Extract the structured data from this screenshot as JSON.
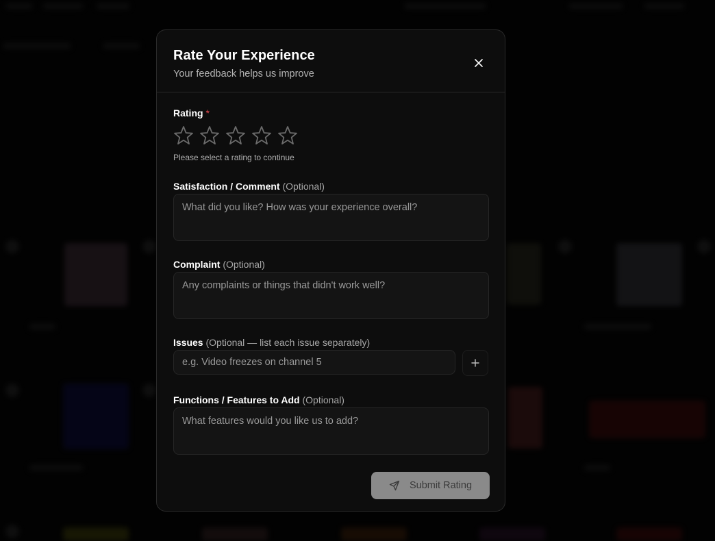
{
  "modal": {
    "title": "Rate Your Experience",
    "subtitle": "Your feedback helps us improve",
    "close_icon": "close-icon"
  },
  "rating": {
    "label": "Rating",
    "required_marker": "*",
    "stars_total": 5,
    "stars_selected": 0,
    "hint": "Please select a rating to continue"
  },
  "comment": {
    "label": "Satisfaction / Comment",
    "optional": "(Optional)",
    "placeholder": "What did you like? How was your experience overall?"
  },
  "complaint": {
    "label": "Complaint",
    "optional": "(Optional)",
    "placeholder": "Any complaints or things that didn't work well?"
  },
  "issues": {
    "label": "Issues",
    "optional": "(Optional — list each issue separately)",
    "placeholder": "e.g. Video freezes on channel 5",
    "add_icon": "plus-icon"
  },
  "features": {
    "label": "Functions / Features to Add",
    "optional": "(Optional)",
    "placeholder": "What features would you like us to add?"
  },
  "submit": {
    "label": "Submit Rating",
    "icon": "send-icon"
  },
  "colors": {
    "modal_bg": "#0d0d0d",
    "required": "#e5484d",
    "submit_bg": "#8a8a8a"
  }
}
